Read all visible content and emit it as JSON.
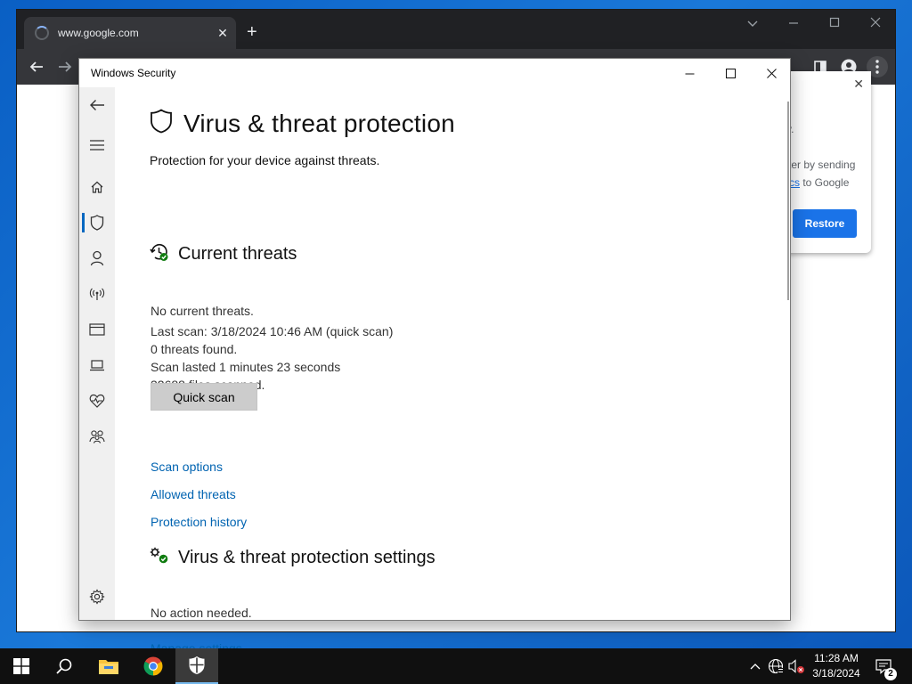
{
  "browser": {
    "tab_title": "www.google.com",
    "tab_close": "✕",
    "new_tab": "+",
    "popup": {
      "frag1": "y.",
      "frag2": "ter by sending",
      "frag3_link": "cs",
      "frag3_text": " to Google",
      "restore_label": "Restore",
      "close": "✕"
    }
  },
  "window": {
    "title": "Windows Security"
  },
  "page": {
    "title": "Virus & threat protection",
    "subtitle": "Protection for your device against threats."
  },
  "current_threats": {
    "title": "Current threats",
    "status": "No current threats.",
    "last_scan": "Last scan: 3/18/2024 10:46 AM (quick scan)",
    "threats_found": "0 threats found.",
    "scan_duration": "Scan lasted 1 minutes 23 seconds",
    "files_scanned": "32688 files scanned.",
    "quick_scan_label": "Quick scan",
    "links": [
      "Scan options",
      "Allowed threats",
      "Protection history"
    ]
  },
  "settings_section": {
    "title": "Virus & threat protection settings",
    "status": "No action needed.",
    "manage_link": "Manage settings"
  },
  "sidebar": {
    "items": [
      "back-icon",
      "menu-icon",
      "home-icon",
      "shield-icon",
      "account-icon",
      "firewall-icon",
      "app-browser-icon",
      "device-security-icon",
      "device-health-icon",
      "family-icon",
      "settings-icon"
    ],
    "active": "shield-icon"
  },
  "taskbar": {
    "time": "11:28 AM",
    "date": "3/18/2024",
    "notification_count": "2"
  },
  "colors": {
    "link": "#0063b1",
    "accent": "#0067c0",
    "chrome_restore": "#1a73e8",
    "status_ok": "#107c10"
  }
}
